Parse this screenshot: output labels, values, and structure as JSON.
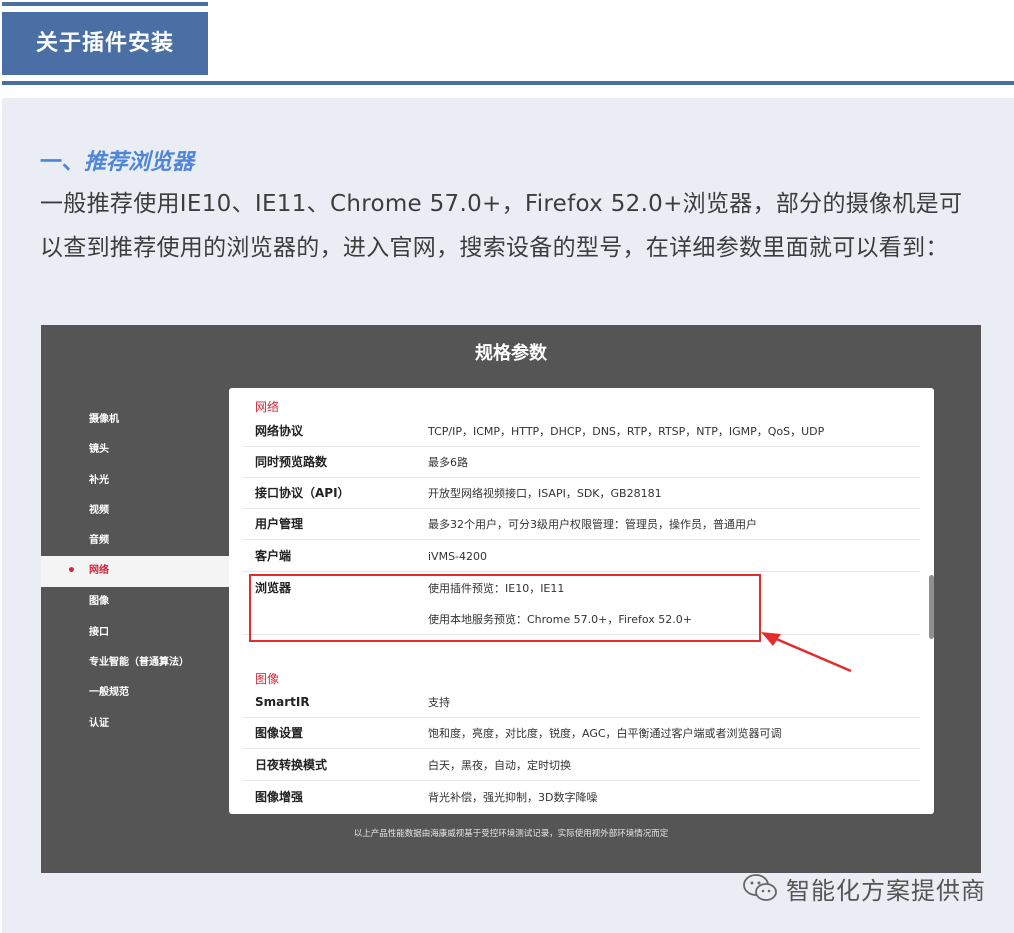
{
  "header": {
    "title": "关于插件安装"
  },
  "section": {
    "heading_prefix": "一、",
    "heading_text": "推荐浏览器",
    "paragraph": "一般推荐使用IE10、IE11、Chrome 57.0+，Firefox 52.0+浏览器，部分的摄像机是可以查到推荐使用的浏览器的，进入官网，搜索设备的型号，在详细参数里面就可以看到："
  },
  "screenshot": {
    "title": "规格参数",
    "nav": [
      {
        "label": "摄像机",
        "active": false
      },
      {
        "label": "镜头",
        "active": false
      },
      {
        "label": "补光",
        "active": false
      },
      {
        "label": "视频",
        "active": false
      },
      {
        "label": "音频",
        "active": false
      },
      {
        "label": "网络",
        "active": true
      },
      {
        "label": "图像",
        "active": false
      },
      {
        "label": "接口",
        "active": false
      },
      {
        "label": "专业智能（普通算法）",
        "active": false
      },
      {
        "label": "一般规范",
        "active": false
      },
      {
        "label": "认证",
        "active": false
      }
    ],
    "groups": [
      {
        "name": "网络",
        "rows": [
          {
            "key": "网络协议",
            "values": [
              "TCP/IP，ICMP，HTTP，DHCP，DNS，RTP，RTSP，NTP，IGMP，QoS，UDP"
            ]
          },
          {
            "key": "同时预览路数",
            "values": [
              "最多6路"
            ]
          },
          {
            "key": "接口协议（API）",
            "values": [
              "开放型网络视频接口，ISAPI，SDK，GB28181"
            ]
          },
          {
            "key": "用户管理",
            "values": [
              "最多32个用户，可分3级用户权限管理：管理员，操作员，普通用户"
            ]
          },
          {
            "key": "客户端",
            "values": [
              "iVMS-4200"
            ]
          },
          {
            "key": "浏览器",
            "values": [
              "使用插件预览：IE10，IE11",
              "使用本地服务预览：Chrome 57.0+，Firefox 52.0+"
            ]
          }
        ]
      },
      {
        "name": "图像",
        "rows": [
          {
            "key": "SmartIR",
            "values": [
              "支持"
            ]
          },
          {
            "key": "图像设置",
            "values": [
              "饱和度，亮度，对比度，锐度，AGC，白平衡通过客户端或者浏览器可调"
            ]
          },
          {
            "key": "日夜转换模式",
            "values": [
              "白天，黑夜，自动，定时切换"
            ]
          },
          {
            "key": "图像增强",
            "values": [
              "背光补偿，强光抑制，3D数字降噪"
            ]
          }
        ]
      }
    ],
    "footnote": "以上产品性能数据由海康威视基于受控环境测试记录，实际使用视外部环境情况而定"
  },
  "watermark": {
    "text": "智能化方案提供商",
    "icon": "wechat-icon"
  },
  "colors": {
    "brand_blue": "#4a6fa5",
    "heading_blue": "#4f86d9",
    "highlight_red": "#e52c2c",
    "panel_bg": "#eaeef4"
  }
}
